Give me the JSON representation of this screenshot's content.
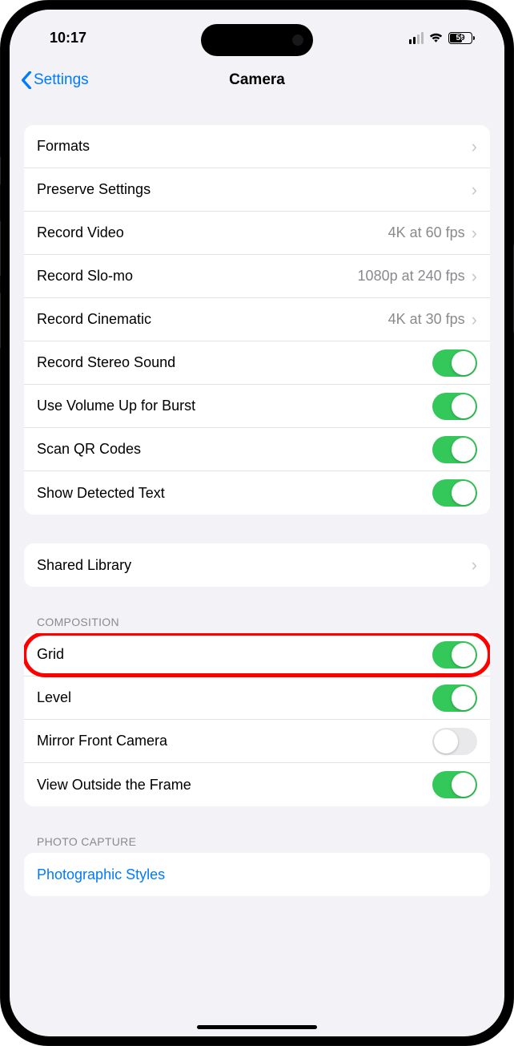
{
  "status": {
    "time": "10:17",
    "battery_level": "59"
  },
  "nav": {
    "back_label": "Settings",
    "title": "Camera"
  },
  "groups": {
    "main": {
      "formats": "Formats",
      "preserve": "Preserve Settings",
      "record_video": "Record Video",
      "record_video_val": "4K at 60 fps",
      "record_slomo": "Record Slo-mo",
      "record_slomo_val": "1080p at 240 fps",
      "record_cinematic": "Record Cinematic",
      "record_cinematic_val": "4K at 30 fps",
      "stereo": "Record Stereo Sound",
      "volume_burst": "Use Volume Up for Burst",
      "scan_qr": "Scan QR Codes",
      "detected_text": "Show Detected Text"
    },
    "library": {
      "shared_library": "Shared Library"
    },
    "composition": {
      "header": "Composition",
      "grid": "Grid",
      "level": "Level",
      "mirror_front": "Mirror Front Camera",
      "view_outside": "View Outside the Frame"
    },
    "capture": {
      "header": "Photo Capture",
      "photographic_styles": "Photographic Styles"
    }
  }
}
